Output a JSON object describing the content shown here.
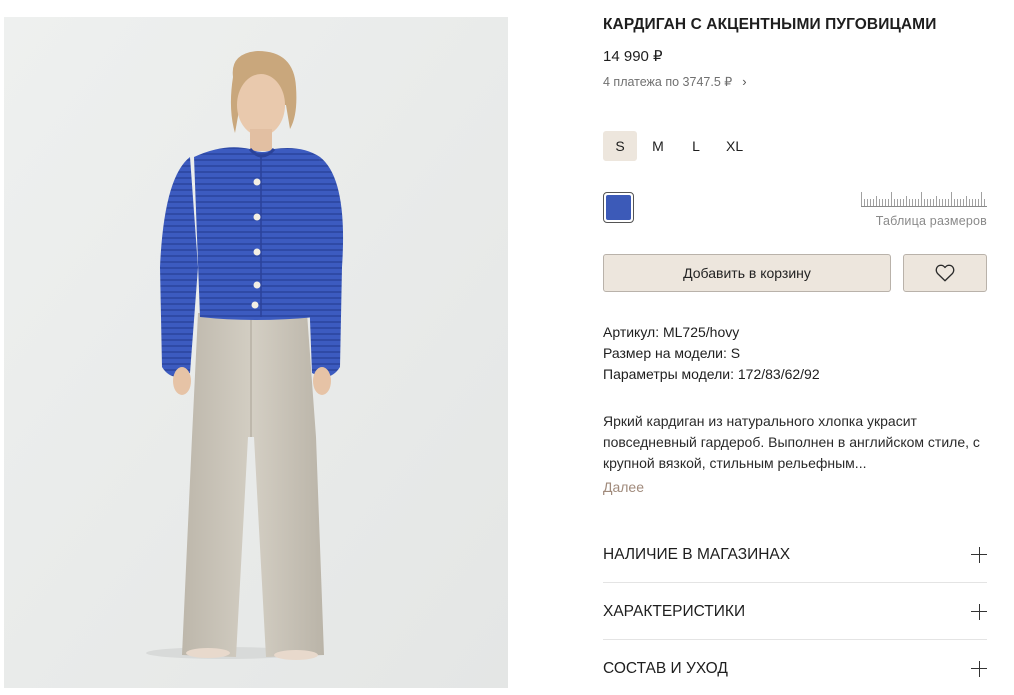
{
  "product": {
    "title": "КАРДИГАН С АКЦЕНТНЫМИ ПУГОВИЦАМИ",
    "price": "14 990 ₽",
    "installments": "4 платежа по 3747.5 ₽",
    "installments_chevron": "›"
  },
  "sizes": {
    "options": [
      "S",
      "M",
      "L",
      "XL"
    ],
    "selected": "S"
  },
  "colors": {
    "selected_swatch": "#3c5ab8",
    "accent_bg": "#ede6dd",
    "link_color": "#a08a7b"
  },
  "size_table": {
    "label": "Таблица размеров",
    "icon": "ruler-icon"
  },
  "actions": {
    "add_to_cart": "Добавить в корзину",
    "favorite_icon": "heart-icon"
  },
  "specs": {
    "article": "Артикул: ML725/hovy",
    "model_size": "Размер на модели: S",
    "model_params": "Параметры модели: 172/83/62/92"
  },
  "description": {
    "text": "Яркий кардиган из натурального хлопка украсит повседневный гардероб. Выполнен в английском стиле, с крупной вязкой, стильным рельефным...",
    "more_label": "Далее"
  },
  "accordion": [
    {
      "label": "НАЛИЧИЕ В МАГАЗИНАХ",
      "icon": "plus-icon"
    },
    {
      "label": "ХАРАКТЕРИСТИКИ",
      "icon": "plus-icon"
    },
    {
      "label": "СОСТАВ И УХОД",
      "icon": "plus-icon"
    }
  ]
}
